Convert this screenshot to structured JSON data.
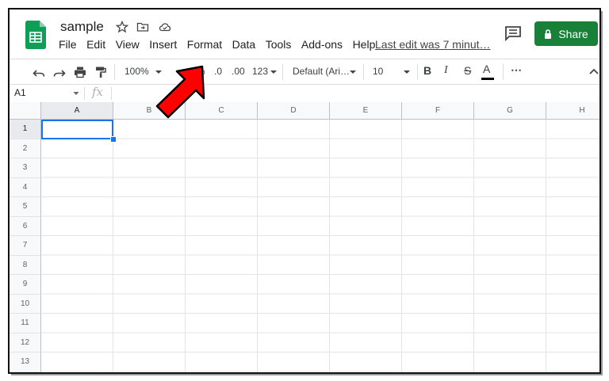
{
  "document": {
    "title": "sample"
  },
  "menu": [
    "File",
    "Edit",
    "View",
    "Insert",
    "Format",
    "Data",
    "Tools",
    "Add-ons",
    "Help"
  ],
  "last_edit": "Last edit was 7 minut…",
  "share": {
    "label": "Share",
    "color": "#188038"
  },
  "toolbar": {
    "zoom": "100%",
    "percent": "%",
    "decrease_decimal": ".0",
    "increase_decimal": ".00",
    "more_formats": "123",
    "font": "Default (Ari…",
    "font_size": "10",
    "bold": "B",
    "italic": "I",
    "strikethrough": "S",
    "text_color": "A",
    "more": "⋯"
  },
  "formula_bar": {
    "name_box": "A1",
    "fx_label": "fx"
  },
  "grid": {
    "columns": [
      "A",
      "B",
      "C",
      "D",
      "E",
      "F",
      "G",
      "H"
    ],
    "rows": [
      "1",
      "2",
      "3",
      "4",
      "5",
      "6",
      "7",
      "8",
      "9",
      "10",
      "11",
      "12",
      "13"
    ],
    "selected_cell": "A1",
    "selection_color": "#1a73e8"
  },
  "annotation": {
    "arrow_color": "#ff0000",
    "points_to": "Format"
  }
}
